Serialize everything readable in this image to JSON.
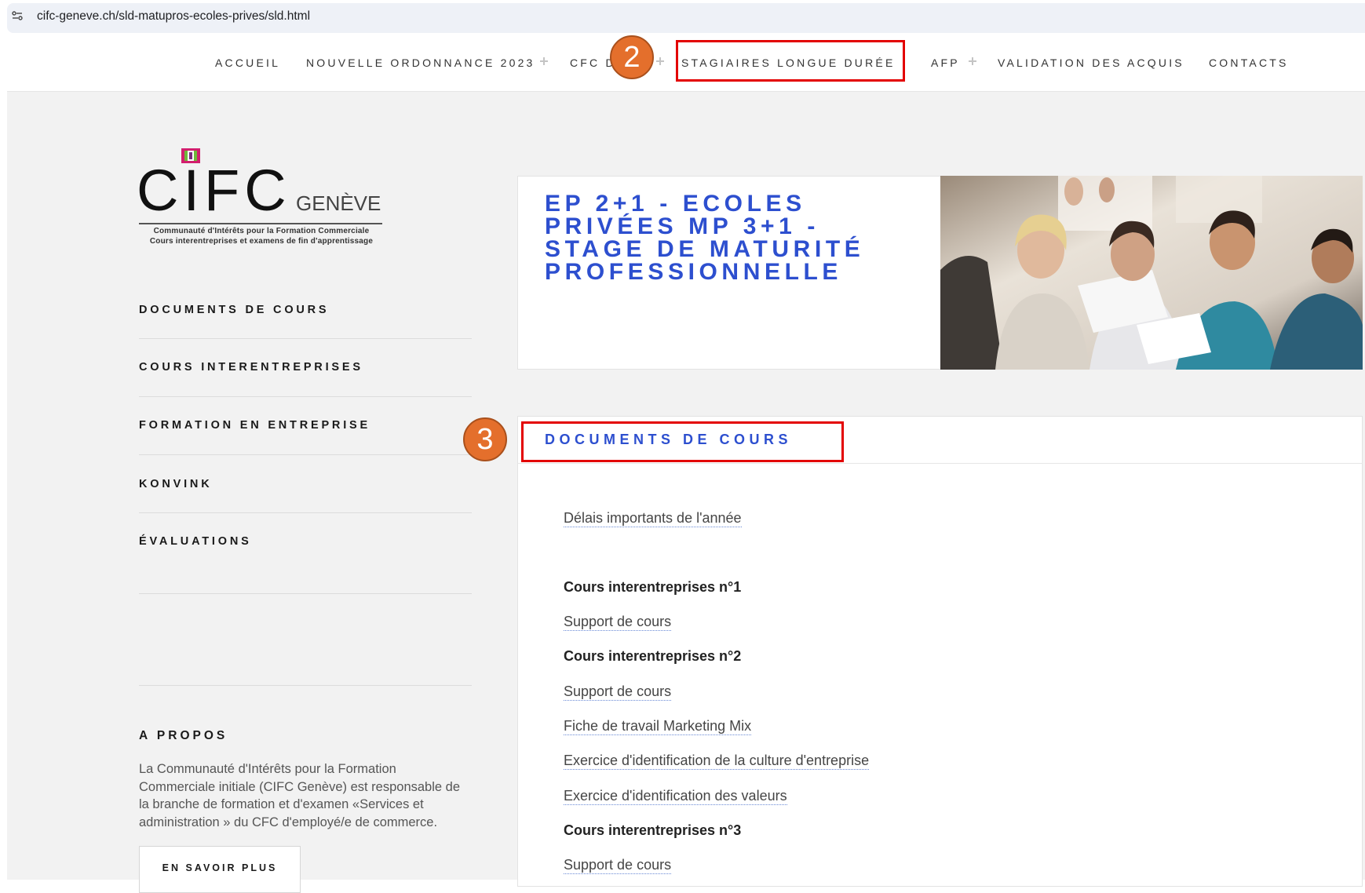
{
  "browser": {
    "url": "cifc-geneve.ch/sld-matupros-ecoles-prives/sld.html",
    "site_icon": "site-settings-icon"
  },
  "nav": {
    "items": [
      {
        "label": "ACCUEIL",
        "has_plus": false
      },
      {
        "label": "NOUVELLE ORDONNANCE 2023",
        "has_plus": true
      },
      {
        "label": "CFC D",
        "has_plus": true
      },
      {
        "label": "STAGIAIRES LONGUE DURÉE",
        "has_plus": false
      },
      {
        "label": "AFP",
        "has_plus": true
      },
      {
        "label": "VALIDATION DES ACQUIS",
        "has_plus": false
      },
      {
        "label": "CONTACTS",
        "has_plus": false
      }
    ]
  },
  "annotations": {
    "callout_nav": "2",
    "callout_docs": "3",
    "highlight_color": "#e30000",
    "callout_color": "#e46f2c"
  },
  "logo": {
    "name": "CIFC",
    "city": "GENÈVE",
    "subtitle_1": "Communauté d'Intérêts pour la Formation Commerciale",
    "subtitle_2": "Cours interentreprises et examens de fin d'apprentissage"
  },
  "sidebar": {
    "items": [
      {
        "label": "DOCUMENTS DE COURS"
      },
      {
        "label": "COURS INTERENTREPRISES"
      },
      {
        "label": "FORMATION EN ENTREPRISE"
      },
      {
        "label": "KONVINK"
      },
      {
        "label": "ÉVALUATIONS"
      }
    ]
  },
  "about": {
    "title": "A PROPOS",
    "text": "La Communauté d'Intérêts pour la Formation Commerciale initiale (CIFC Genève) est responsable de la branche de formation et d'examen «Services et administration » du CFC d'employé/e de commerce.",
    "button": "EN SAVOIR PLUS"
  },
  "hero": {
    "title_lines": [
      "EP 2+1 - ECOLES",
      "PRIVÉES MP 3+1 -",
      "STAGE DE MATURITÉ",
      "PROFESSIONNELLE"
    ],
    "title_color": "#2d4fcf"
  },
  "documents": {
    "title": "DOCUMENTS DE COURS",
    "items": [
      {
        "text": "Délais importants de l'année",
        "type": "link"
      },
      {
        "text": "Cours interentreprises n°1",
        "type": "heading"
      },
      {
        "text": "Support de cours",
        "type": "link"
      },
      {
        "text": "Cours interentreprises n°2",
        "type": "heading"
      },
      {
        "text": "Support de cours",
        "type": "link"
      },
      {
        "text": "Fiche de travail Marketing Mix",
        "type": "link"
      },
      {
        "text": "Exercice d'identification de la culture d'entreprise",
        "type": "link"
      },
      {
        "text": "Exercice d'identification des valeurs",
        "type": "link"
      },
      {
        "text": "Cours interentreprises n°3",
        "type": "heading"
      },
      {
        "text": "Support de cours",
        "type": "link"
      }
    ]
  }
}
